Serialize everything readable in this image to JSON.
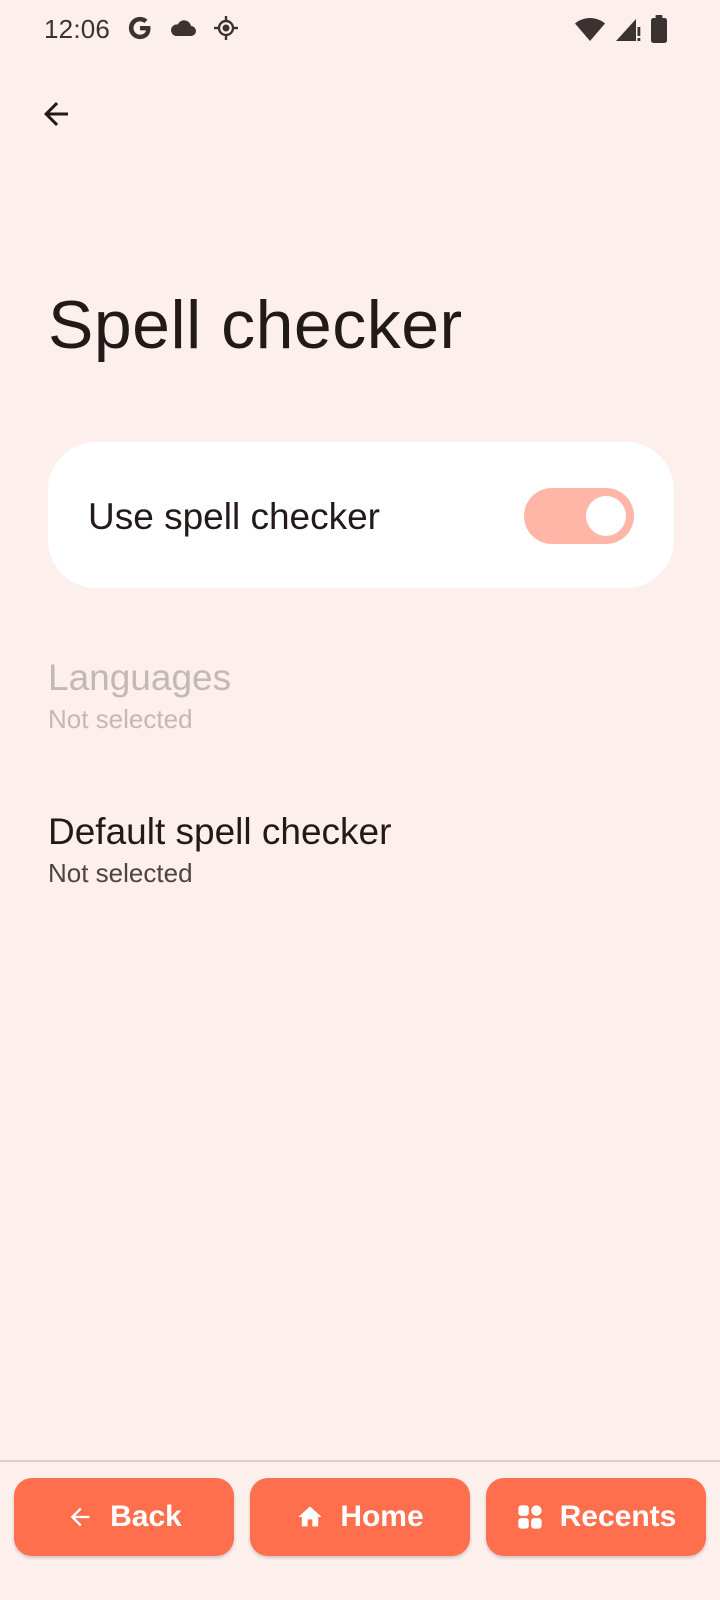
{
  "status_bar": {
    "time": "12:06",
    "icons_left": [
      "google-icon",
      "cloud-icon",
      "location-icon"
    ],
    "icons_right": [
      "wifi-icon",
      "cell-signal-icon",
      "battery-icon"
    ]
  },
  "header": {
    "title": "Spell checker"
  },
  "main_toggle": {
    "label": "Use spell checker",
    "checked": true
  },
  "preferences": [
    {
      "title": "Languages",
      "summary": "Not selected",
      "enabled": false
    },
    {
      "title": "Default spell checker",
      "summary": "Not selected",
      "enabled": true
    }
  ],
  "nav": {
    "back_label": "Back",
    "home_label": "Home",
    "recents_label": "Recents"
  },
  "colors": {
    "background": "#fcefec",
    "accent": "#ff6f4e",
    "switch_track": "#ffb6a6"
  }
}
